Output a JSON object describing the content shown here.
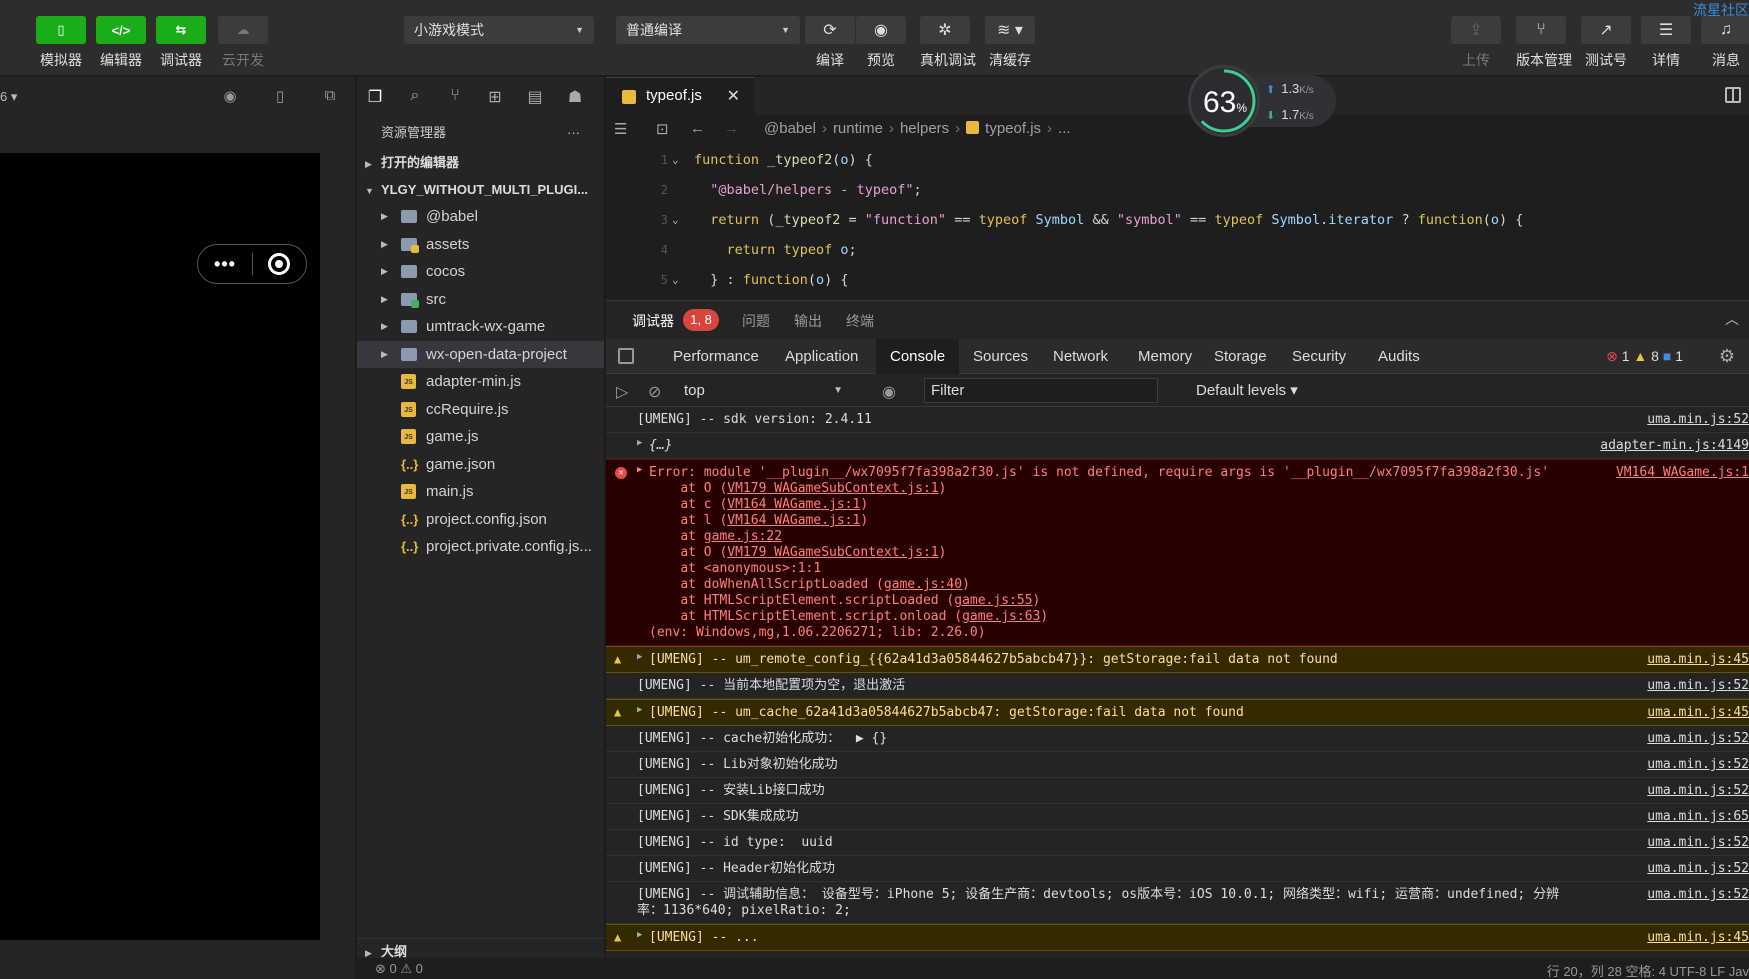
{
  "toolbar": {
    "simulator": "模拟器",
    "editor": "编辑器",
    "debugger": "调试器",
    "cloud": "云开发",
    "mode_select": "小游戏模式",
    "compile_select": "普通编译",
    "compile": "编译",
    "preview": "预览",
    "real_debug": "真机调试",
    "clear_cache": "清缓存",
    "upload": "上传",
    "version_mgmt": "版本管理",
    "test_account": "测试号",
    "details": "详情",
    "messages": "消息",
    "corner_text": "流星社区"
  },
  "simulator": {
    "zoom": "6 ▾"
  },
  "explorer": {
    "title": "资源管理器",
    "open_editors": "打开的编辑器",
    "project": "YLGY_WITHOUT_MULTI_PLUGI...",
    "items": [
      {
        "label": "@babel",
        "type": "folder"
      },
      {
        "label": "assets",
        "type": "assets"
      },
      {
        "label": "cocos",
        "type": "folder"
      },
      {
        "label": "src",
        "type": "src"
      },
      {
        "label": "umtrack-wx-game",
        "type": "folder"
      },
      {
        "label": "wx-open-data-project",
        "type": "folder"
      },
      {
        "label": "adapter-min.js",
        "type": "js"
      },
      {
        "label": "ccRequire.js",
        "type": "js"
      },
      {
        "label": "game.js",
        "type": "js"
      },
      {
        "label": "game.json",
        "type": "json"
      },
      {
        "label": "main.js",
        "type": "js"
      },
      {
        "label": "project.config.json",
        "type": "json"
      },
      {
        "label": "project.private.config.js...",
        "type": "json"
      }
    ],
    "outline": "大纲",
    "problems": "⊗ 0 ⚠ 0"
  },
  "editor": {
    "tab_name": "typeof.js",
    "breadcrumb": [
      "@babel",
      "runtime",
      "helpers",
      "typeof.js",
      "..."
    ],
    "lines": [
      "1",
      "2",
      "3",
      "4",
      "5"
    ]
  },
  "gauge": {
    "percent": "63",
    "unit": "%",
    "up": "1.3",
    "down": "1.7",
    "rate_unit": "K/s"
  },
  "debug": {
    "tab_debugger": "调试器",
    "badge": "1, 8",
    "tab_problems": "问题",
    "tab_output": "输出",
    "tab_terminal": "终端",
    "devtools_tabs": [
      "Performance",
      "Application",
      "Console",
      "Sources",
      "Network",
      "Memory",
      "Storage",
      "Security",
      "Audits"
    ],
    "errors": "1",
    "warnings": "8",
    "infos": "1",
    "context": "top",
    "filter_placeholder": "Filter",
    "levels": "Default levels"
  },
  "console": {
    "r1": {
      "msg": "[UMENG] -- sdk version: 2.4.11",
      "src": "uma.min.js:52"
    },
    "r2": {
      "msg": "{…}",
      "src": "adapter-min.js:4149"
    },
    "err": {
      "msg": "Error: module '__plugin__/wx7095f7fa398a2f30.js' is not defined, require args is '__plugin__/wx7095f7fa398a2f30.js'",
      "src": "VM164 WAGame.js:1",
      "s1a": "    at O (",
      "s1b": "VM179 WAGameSubContext.js:1",
      "s1c": ")",
      "s2a": "    at c (",
      "s2b": "VM164 WAGame.js:1",
      "s2c": ")",
      "s3a": "    at l (",
      "s3b": "VM164 WAGame.js:1",
      "s3c": ")",
      "s4a": "    at ",
      "s4b": "game.js:22",
      "s5a": "    at O (",
      "s5b": "VM179 WAGameSubContext.js:1",
      "s5c": ")",
      "s6": "    at <anonymous>:1:1",
      "s7a": "    at doWhenAllScriptLoaded (",
      "s7b": "game.js:40",
      "s7c": ")",
      "s8a": "    at HTMLScriptElement.scriptLoaded (",
      "s8b": "game.js:55",
      "s8c": ")",
      "s9a": "    at HTMLScriptElement.script.onload (",
      "s9b": "game.js:63",
      "s9c": ")",
      "env": "(env: Windows,mg,1.06.2206271; lib: 2.26.0)"
    },
    "w1": {
      "msg": "[UMENG] -- um_remote_config_{{62a41d3a05844627b5abcb47}}: getStorage:fail data not found",
      "src": "uma.min.js:45"
    },
    "r3": {
      "msg": "[UMENG] -- 当前本地配置项为空，退出激活",
      "src": "uma.min.js:52"
    },
    "w2": {
      "msg": "[UMENG] -- um_cache_62a41d3a05844627b5abcb47: getStorage:fail data not found",
      "src": "uma.min.js:45"
    },
    "r4": {
      "msg": "[UMENG] -- cache初始化成功：  ▶ {}",
      "src": "uma.min.js:52"
    },
    "r5": {
      "msg": "[UMENG] -- Lib对象初始化成功",
      "src": "uma.min.js:52"
    },
    "r6": {
      "msg": "[UMENG] -- 安装Lib接口成功",
      "src": "uma.min.js:52"
    },
    "r7": {
      "msg": "[UMENG] -- SDK集成成功",
      "src": "uma.min.js:65"
    },
    "r8": {
      "msg": "[UMENG] -- id type:  uuid",
      "src": "uma.min.js:52"
    },
    "r9": {
      "msg": "[UMENG] -- Header初始化成功",
      "src": "uma.min.js:52"
    },
    "r10": {
      "msg": "[UMENG] -- 调试辅助信息： 设备型号：iPhone 5; 设备生产商：devtools; os版本号：iOS 10.0.1; 网络类型：wifi; 运营商：undefined; 分辨率：1136*640; pixelRatio: 2;",
      "src": "uma.min.js:52"
    },
    "r11": {
      "msg": "[UMENG] -- ...",
      "src": "uma.min.js:45"
    }
  },
  "status": {
    "right": "行 20，列 28    空格: 4    UTF-8    LF    Jav"
  }
}
